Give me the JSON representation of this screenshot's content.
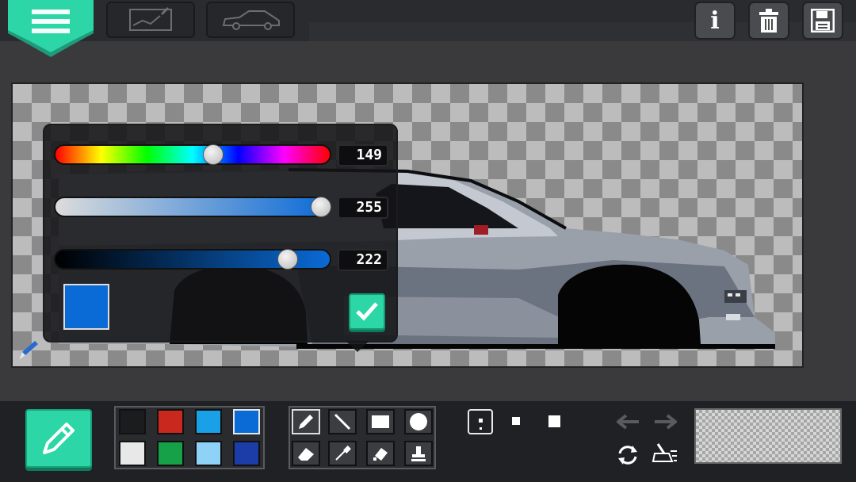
{
  "header": {
    "menu_icon": "hamburger-menu-icon",
    "tabs": [
      {
        "icon": "drawing-sketch-icon"
      },
      {
        "icon": "car-outline-icon"
      }
    ],
    "actions": [
      {
        "icon": "info-icon",
        "label": "i"
      },
      {
        "icon": "trash-icon"
      },
      {
        "icon": "save-disk-icon"
      }
    ]
  },
  "color_picker": {
    "hue_value": "149",
    "saturation_value": "255",
    "brightness_value": "222",
    "hue_level": 0.58,
    "saturation_level": 1.0,
    "brightness_level": 0.87,
    "preview_color": "#0a6ad6",
    "confirm_icon": "checkmark-icon"
  },
  "toolbar": {
    "current_tool_icon": "pencil-icon",
    "palette": [
      "#1b1c1e",
      "#c8281e",
      "#1aa0e6",
      "#0a6ad6",
      "#e8e8e8",
      "#16a048",
      "#8fd2f8",
      "#1c3ca8"
    ],
    "tools": [
      {
        "icon": "pencil-icon",
        "selected": true
      },
      {
        "icon": "line-icon"
      },
      {
        "icon": "rectangle-icon"
      },
      {
        "icon": "circle-icon"
      },
      {
        "icon": "eraser-icon"
      },
      {
        "icon": "eyedropper-icon"
      },
      {
        "icon": "fill-bucket-icon"
      },
      {
        "icon": "stamp-icon"
      }
    ],
    "brush_sizes": [
      "1",
      "2",
      "3"
    ],
    "undo_icon": "undo-arrow-icon",
    "redo_icon": "redo-arrow-icon",
    "rotate_icon": "rotate-icon",
    "clear_icon": "sweep-clear-icon"
  },
  "colors": {
    "accent": "#2dd6a6",
    "background": "#3a3a3c"
  }
}
